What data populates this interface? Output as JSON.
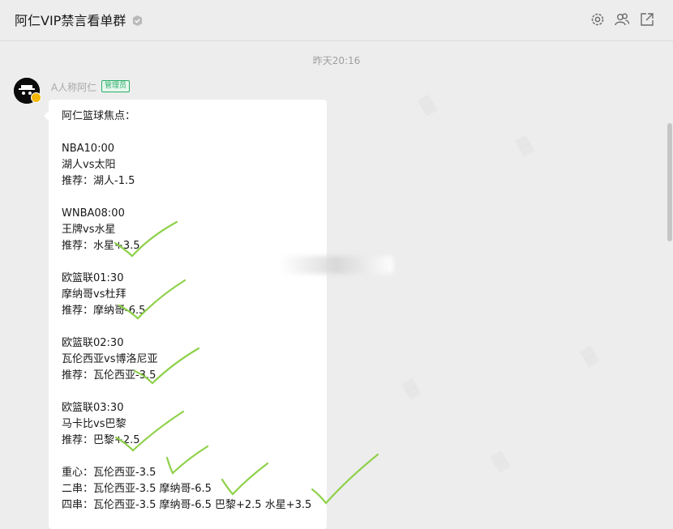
{
  "header": {
    "title": "阿仁VIP禁言看单群",
    "icons": [
      "verified-icon",
      "settings-icon",
      "members-icon",
      "popout-icon"
    ]
  },
  "chat": {
    "timestamp": "昨天20:16",
    "message": {
      "sender": "A人称阿仁",
      "badge": "管理员",
      "lines": [
        "阿仁篮球焦点：",
        "NBA10:00",
        "湖人vs太阳",
        "推荐：湖人-1.5",
        "WNBA08:00",
        "王牌vs水星",
        "推荐：水星+3.5",
        "欧篮联01:30",
        "摩纳哥vs杜拜",
        "推荐：摩纳哥-6.5",
        "欧篮联02:30",
        "瓦伦西亚vs博洛尼亚",
        "推荐：瓦伦西亚-3.5",
        "欧篮联03:30",
        "马卡比vs巴黎",
        "推荐：巴黎+2.5",
        "重心：瓦伦西亚-3.5",
        "二串：瓦伦西亚-3.5 摩纳哥-6.5",
        "四串：瓦伦西亚-3.5 摩纳哥-6.5 巴黎+2.5 水星+3.5"
      ]
    }
  },
  "colors": {
    "background": "#ededed",
    "bubble": "#ffffff",
    "admin_badge": "#2aae67",
    "check_mark": "#8ed14a"
  }
}
